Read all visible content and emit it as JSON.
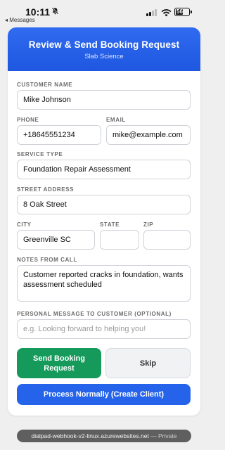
{
  "status_bar": {
    "time": "10:11",
    "back_label": "◂ Messages",
    "battery": "56"
  },
  "header": {
    "title": "Review & Send Booking Request",
    "subtitle": "Slab Science"
  },
  "form": {
    "customer_name": {
      "label": "CUSTOMER NAME",
      "value": "Mike Johnson"
    },
    "phone": {
      "label": "PHONE",
      "value": "+18645551234"
    },
    "email": {
      "label": "EMAIL",
      "value": "mike@example.com"
    },
    "service_type": {
      "label": "SERVICE TYPE",
      "value": "Foundation Repair Assessment"
    },
    "street_address": {
      "label": "STREET ADDRESS",
      "value": "8 Oak Street"
    },
    "city": {
      "label": "CITY",
      "value": "Greenville SC"
    },
    "state": {
      "label": "STATE",
      "value": ""
    },
    "zip": {
      "label": "ZIP",
      "value": ""
    },
    "notes": {
      "label": "NOTES FROM CALL",
      "value": "Customer reported cracks in foundation, wants assessment scheduled"
    },
    "personal_message": {
      "label": "PERSONAL MESSAGE TO CUSTOMER (OPTIONAL)",
      "value": "",
      "placeholder": "e.g. Looking forward to helping you!"
    }
  },
  "actions": {
    "send_label": "Send Booking Request",
    "skip_label": "Skip",
    "process_label": "Process Normally (Create Client)"
  },
  "footer": {
    "url": "dialpad-webhook-v2-linux.azurewebsites.net",
    "private_label": "— Private"
  },
  "colors": {
    "header": "#2563eb",
    "send": "#159a5b",
    "process": "#2563eb"
  }
}
